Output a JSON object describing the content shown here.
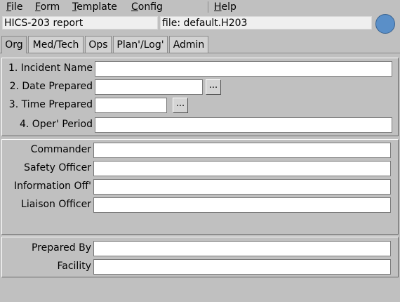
{
  "menu": {
    "file": {
      "u": "F",
      "rest": "ile"
    },
    "form": {
      "u": "F",
      "rest": "orm"
    },
    "template": {
      "u": "T",
      "rest": "emplate"
    },
    "config": {
      "u": "C",
      "rest": "onfig"
    },
    "help": {
      "u": "H",
      "rest": "elp"
    }
  },
  "header": {
    "report_title": "HICS-203 report",
    "file_label": "file: default.H203",
    "status_color": "#5a8fc8"
  },
  "tabs": [
    "Org",
    "Med/Tech",
    "Ops",
    "Plan'/Log'",
    "Admin"
  ],
  "active_tab": "Org",
  "section1": {
    "incident_name": {
      "label": "1. Incident Name",
      "value": ""
    },
    "date_prepared": {
      "label": "2. Date Prepared",
      "value": ""
    },
    "time_prepared": {
      "label": "3. Time Prepared",
      "value": ""
    },
    "oper_period": {
      "label": "4. Oper' Period",
      "value": ""
    },
    "picker_label": "..."
  },
  "section2": {
    "commander": {
      "label": "Commander",
      "value": ""
    },
    "safety_officer": {
      "label": "Safety Officer",
      "value": ""
    },
    "information_officer": {
      "label": "Information Off'",
      "value": ""
    },
    "liaison_officer": {
      "label": "Liaison Officer",
      "value": ""
    }
  },
  "section3": {
    "prepared_by": {
      "label": "Prepared By",
      "value": ""
    },
    "facility": {
      "label": "Facility",
      "value": ""
    }
  }
}
